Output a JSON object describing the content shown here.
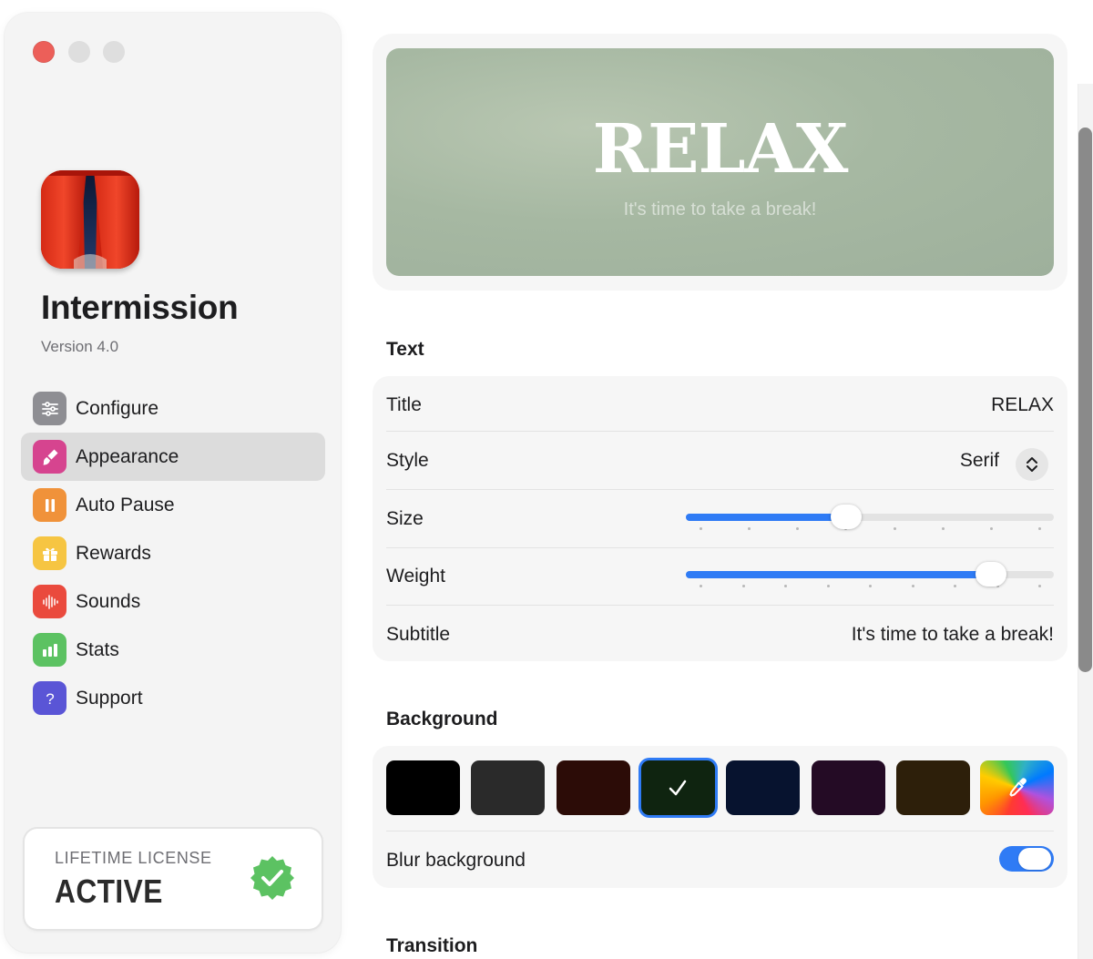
{
  "window": {
    "controls": [
      "close",
      "minimize",
      "zoom"
    ]
  },
  "sidebar": {
    "app_name": "Intermission",
    "version": "Version 4.0",
    "items": [
      {
        "label": "Configure",
        "icon": "sliders-icon",
        "color": "#8e8e93",
        "selected": false
      },
      {
        "label": "Appearance",
        "icon": "paintbrush-icon",
        "color": "#d6448f",
        "selected": true
      },
      {
        "label": "Auto Pause",
        "icon": "pause-icon",
        "color": "#f0923a",
        "selected": false
      },
      {
        "label": "Rewards",
        "icon": "gift-icon",
        "color": "#f6c542",
        "selected": false
      },
      {
        "label": "Sounds",
        "icon": "waveform-icon",
        "color": "#ea4a3d",
        "selected": false
      },
      {
        "label": "Stats",
        "icon": "bar-chart-icon",
        "color": "#5cc262",
        "selected": false
      },
      {
        "label": "Support",
        "icon": "question-icon",
        "color": "#5a55d6",
        "selected": false
      }
    ],
    "license": {
      "heading": "LIFETIME LICENSE",
      "status": "ACTIVE",
      "badge_color": "#5cc262"
    }
  },
  "preview": {
    "title": "RELAX",
    "subtitle": "It's time to take a break!"
  },
  "text_section": {
    "heading": "Text",
    "title_label": "Title",
    "title_value": "RELAX",
    "style_label": "Style",
    "style_value": "Serif",
    "size_label": "Size",
    "size_value": 0.43,
    "size_ticks": 8,
    "weight_label": "Weight",
    "weight_value": 0.86,
    "weight_ticks": 9,
    "subtitle_label": "Subtitle",
    "subtitle_value": "It's time to take a break!"
  },
  "background_section": {
    "heading": "Background",
    "swatches": [
      {
        "color": "#000000",
        "selected": false
      },
      {
        "color": "#2a2a2a",
        "selected": false
      },
      {
        "color": "#2c0c07",
        "selected": false
      },
      {
        "color": "#0f2410",
        "selected": true
      },
      {
        "color": "#07132f",
        "selected": false
      },
      {
        "color": "#240b25",
        "selected": false
      },
      {
        "color": "#2d1f0a",
        "selected": false
      }
    ],
    "custom_color_icon": "eyedropper-icon",
    "blur_label": "Blur background",
    "blur_enabled": true
  },
  "transition_section": {
    "heading": "Transition"
  },
  "accent_color": "#2f7bf5"
}
